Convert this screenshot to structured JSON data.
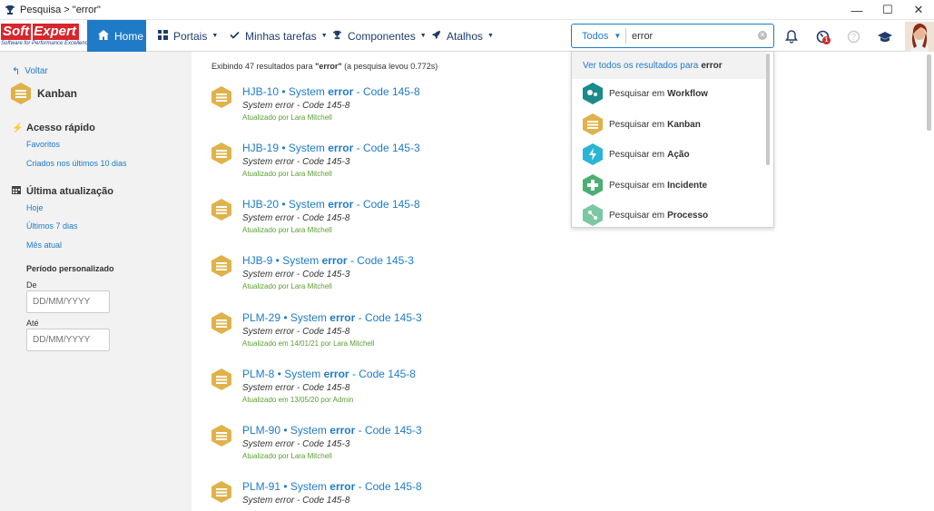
{
  "window": {
    "title": "Pesquisa > \"error\"",
    "controls": [
      "—",
      "☐",
      "✕"
    ]
  },
  "logo": {
    "soft": "Soft",
    "expert": "Expert",
    "tagline": "Software for Performance Excellence"
  },
  "nav": {
    "home": "Home",
    "items": [
      "Portais",
      "Minhas tarefas",
      "Componentes",
      "Atalhos"
    ]
  },
  "search": {
    "scope": "Todos",
    "value": "error"
  },
  "dropdown": {
    "all_prefix": "Ver todos os resultados para",
    "all_term": "error",
    "item_prefix": "Pesquisar em",
    "items": [
      {
        "name": "Workflow",
        "color": "#1a8a8a"
      },
      {
        "name": "Kanban",
        "color": "#e0b24a"
      },
      {
        "name": "Ação",
        "color": "#2ab5d6"
      },
      {
        "name": "Incidente",
        "color": "#4caf72"
      },
      {
        "name": "Processo",
        "color": "#7cc7a4"
      }
    ]
  },
  "sidebar": {
    "back": "Voltar",
    "module": "Kanban",
    "quick_access": {
      "title": "Acesso rápido",
      "links": [
        "Favoritos",
        "Criados nos últimos 10 dias"
      ]
    },
    "last_update": {
      "title": "Última atualização",
      "links": [
        "Hoje",
        "Últimos 7 dias",
        "Mês atual"
      ]
    },
    "custom_period": {
      "title": "Período personalizado",
      "from_label": "De",
      "to_label": "Até",
      "placeholder": "DD/MM/YYYY"
    }
  },
  "summary": {
    "prefix": "Exibindo 47 resultados para",
    "term": "\"error\"",
    "suffix": "(a pesquisa levou 0.772s)"
  },
  "results": [
    {
      "id": "HJB-10",
      "pre": "System",
      "hl": "error",
      "post": "- Code 145-8",
      "desc": "System error - Code 145-8",
      "meta": "Atualizado por Lara Mitchell"
    },
    {
      "id": "HJB-19",
      "pre": "System",
      "hl": "error",
      "post": "- Code 145-3",
      "desc": "System error - Code 145-3",
      "meta": "Atualizado por Lara Mitchell"
    },
    {
      "id": "HJB-20",
      "pre": "System",
      "hl": "error",
      "post": "- Code 145-8",
      "desc": "System error - Code 145-8",
      "meta": "Atualizado por Lara Mitchell"
    },
    {
      "id": "HJB-9",
      "pre": "System",
      "hl": "error",
      "post": "- Code 145-3",
      "desc": "System error - Code 145-3",
      "meta": "Atualizado por Lara Mitchell"
    },
    {
      "id": "PLM-29",
      "pre": "System",
      "hl": "error",
      "post": "- Code 145-3",
      "desc": "System error - Code 145-8",
      "meta": "Atualizado em 14/01/21 por Lara Mitchell"
    },
    {
      "id": "PLM-8",
      "pre": "System",
      "hl": "error",
      "post": "- Code 145-8",
      "desc": "System error - Code 145-8",
      "meta": "Atualizado em 13/05/20 por Admin"
    },
    {
      "id": "PLM-90",
      "pre": "System",
      "hl": "error",
      "post": "- Code 145-3",
      "desc": "System error - Code 145-3",
      "meta": "Atualizado por Lara Mitchell"
    },
    {
      "id": "PLM-91",
      "pre": "System",
      "hl": "error",
      "post": "- Code 145-8",
      "desc": "System error - Code 145-8",
      "meta": ""
    }
  ],
  "colors": {
    "accent": "#1f7bc8",
    "brand_red": "#d7262d",
    "meta_green": "#5a9e32",
    "kanban_gold": "#e0b24a"
  }
}
